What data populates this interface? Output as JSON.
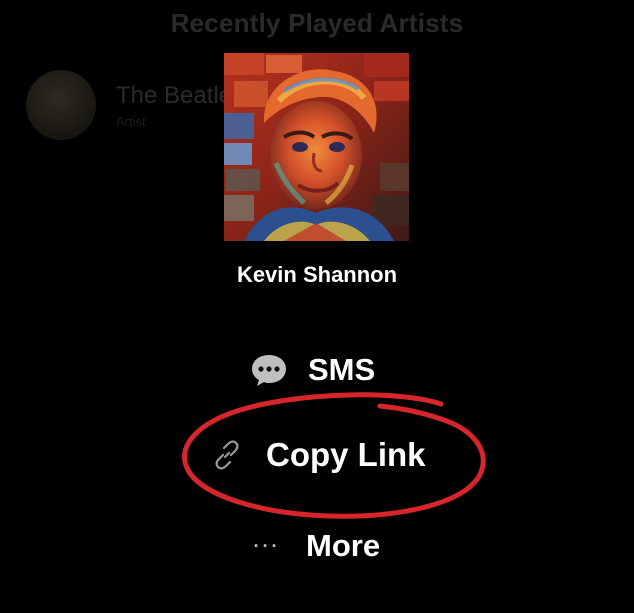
{
  "background": {
    "section_title": "Recently Played Artists",
    "artist": {
      "name": "The Beatles",
      "subtitle": "Artist"
    }
  },
  "share_sheet": {
    "title": "Kevin Shannon",
    "options": [
      {
        "label": "SMS",
        "icon": "chat-bubble-icon"
      },
      {
        "label": "Copy Link",
        "icon": "link-icon"
      },
      {
        "label": "More",
        "icon": "ellipsis-icon"
      }
    ]
  },
  "annotation": {
    "shape": "hand-drawn ellipse",
    "color": "#d7262b",
    "target": "Copy Link"
  }
}
